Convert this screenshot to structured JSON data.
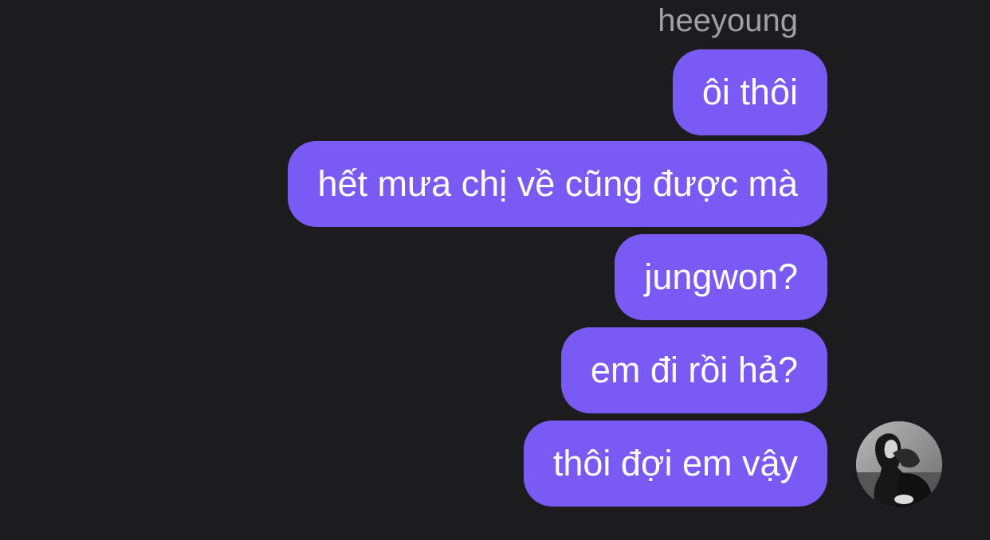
{
  "conversation": {
    "sender_name": "heeyoung",
    "messages": [
      {
        "text": "ôi thôi"
      },
      {
        "text": "hết mưa chị về cũng được mà"
      },
      {
        "text": "jungwon?"
      },
      {
        "text": "em đi rồi hả?"
      },
      {
        "text": "thôi đợi em vậy"
      }
    ]
  },
  "avatar": {
    "icon": "user-photo-avatar",
    "style": "grayscale photo"
  },
  "colors": {
    "background": "#1c1c1e",
    "bubble": "#7a5af5",
    "bubble_text": "#ffffff",
    "sender_name": "#a0a0a6"
  }
}
